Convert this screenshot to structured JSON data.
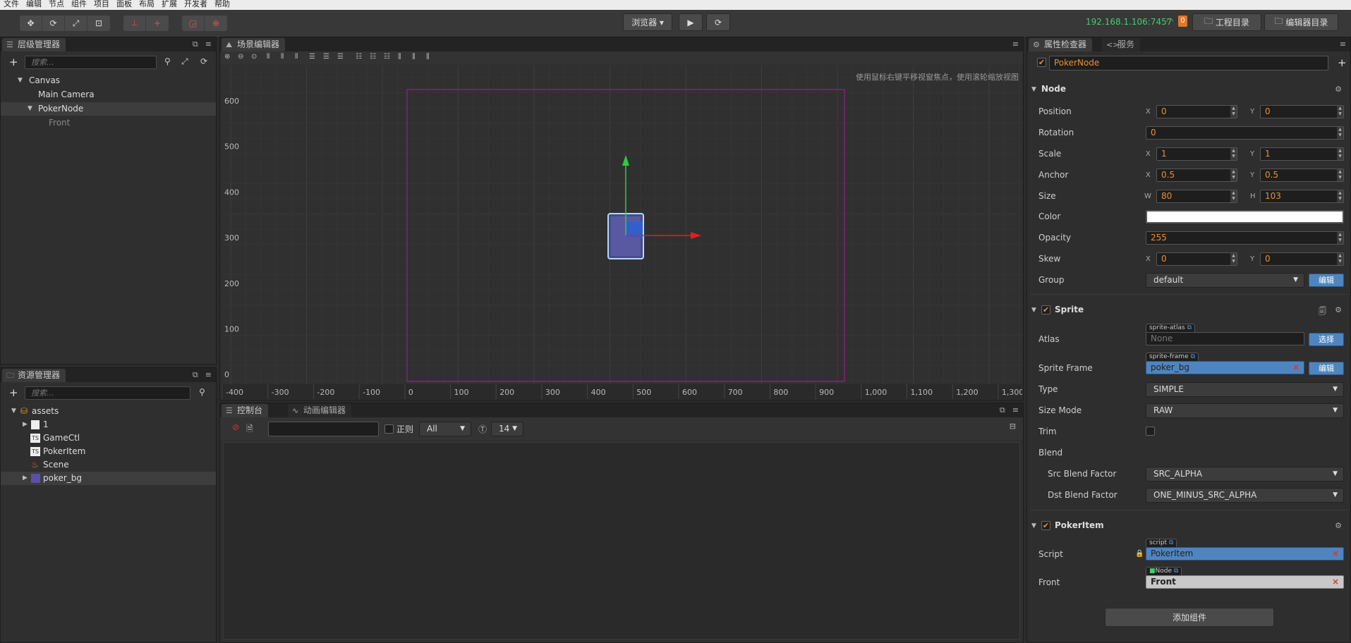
{
  "menubar": [
    "文件",
    "编辑",
    "节点",
    "组件",
    "项目",
    "面板",
    "布局",
    "扩展",
    "开发者",
    "帮助"
  ],
  "toolbar": {
    "browser_select": "浏览器",
    "ip": "192.168.1.106:7457",
    "wifi_count": "0",
    "project_dir": "工程目录",
    "editor_dir": "编辑器目录"
  },
  "hierarchy": {
    "title": "层级管理器",
    "search_placeholder": "搜索...",
    "nodes": [
      "Canvas",
      "Main Camera",
      "PokerNode",
      "Front"
    ]
  },
  "assets": {
    "title": "资源管理器",
    "search_placeholder": "搜索...",
    "items": [
      "assets",
      "1",
      "GameCtl",
      "PokerItem",
      "Scene",
      "poker_bg"
    ]
  },
  "scene": {
    "title": "场景编辑器",
    "hint": "使用鼠标右键平移视窗焦点，使用滚轮缩放视图",
    "y_ticks": [
      "600",
      "500",
      "400",
      "300",
      "200",
      "100",
      "0"
    ],
    "x_ticks": [
      "-400",
      "-300",
      "-200",
      "-100",
      "0",
      "100",
      "200",
      "300",
      "400",
      "500",
      "600",
      "700",
      "800",
      "900",
      "1,000",
      "1,100",
      "1,200",
      "1,300"
    ],
    "accent_color": "#a020a0"
  },
  "console": {
    "tab_console": "控制台",
    "tab_anim": "动画编辑器",
    "regex_label": "正则",
    "level_select": "All",
    "font_size": "14"
  },
  "inspector": {
    "tab_inspector": "属性检查器",
    "tab_service": "服务",
    "node_name": "PokerNode",
    "node_section": "Node",
    "props": {
      "position_label": "Position",
      "pos_x": "0",
      "pos_y": "0",
      "rotation_label": "Rotation",
      "rotation": "0",
      "scale_label": "Scale",
      "scale_x": "1",
      "scale_y": "1",
      "anchor_label": "Anchor",
      "anchor_x": "0.5",
      "anchor_y": "0.5",
      "size_label": "Size",
      "size_w": "80",
      "size_h": "103",
      "color_label": "Color",
      "opacity_label": "Opacity",
      "opacity": "255",
      "skew_label": "Skew",
      "skew_x": "0",
      "skew_y": "0",
      "group_label": "Group",
      "group": "default",
      "group_edit": "编辑"
    },
    "sprite": {
      "title": "Sprite",
      "atlas_label": "Atlas",
      "atlas_tag": "sprite-atlas",
      "atlas_value": "None",
      "atlas_btn": "选择",
      "frame_label": "Sprite Frame",
      "frame_tag": "sprite-frame",
      "frame_value": "poker_bg",
      "frame_btn": "编辑",
      "type_label": "Type",
      "type": "SIMPLE",
      "sizemode_label": "Size Mode",
      "sizemode": "RAW",
      "trim_label": "Trim",
      "blend_label": "Blend",
      "src_label": "Src Blend Factor",
      "src": "SRC_ALPHA",
      "dst_label": "Dst Blend Factor",
      "dst": "ONE_MINUS_SRC_ALPHA"
    },
    "pokeritem": {
      "title": "PokerItem",
      "script_label": "Script",
      "script_tag": "script",
      "script_value": "PokerItem",
      "front_label": "Front",
      "front_tag": "Node",
      "front_value": "Front"
    },
    "add_component": "添加组件"
  }
}
